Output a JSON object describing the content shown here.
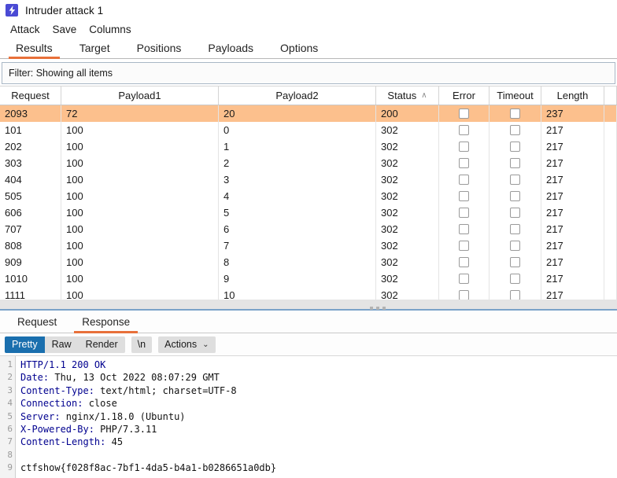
{
  "window": {
    "title": "Intruder attack 1",
    "icon": "lightning-bolt-icon"
  },
  "menubar": {
    "items": [
      {
        "label": "Attack"
      },
      {
        "label": "Save"
      },
      {
        "label": "Columns"
      }
    ]
  },
  "main_tabs": {
    "active": "Results",
    "items": [
      {
        "label": "Results"
      },
      {
        "label": "Target"
      },
      {
        "label": "Positions"
      },
      {
        "label": "Payloads"
      },
      {
        "label": "Options"
      }
    ]
  },
  "filter": {
    "text": "Filter: Showing all items"
  },
  "results_table": {
    "columns": [
      {
        "key": "request",
        "label": "Request",
        "sort": ""
      },
      {
        "key": "payload1",
        "label": "Payload1",
        "sort": ""
      },
      {
        "key": "payload2",
        "label": "Payload2",
        "sort": ""
      },
      {
        "key": "status",
        "label": "Status",
        "sort": "asc"
      },
      {
        "key": "error",
        "label": "Error",
        "sort": ""
      },
      {
        "key": "timeout",
        "label": "Timeout",
        "sort": ""
      },
      {
        "key": "length",
        "label": "Length",
        "sort": ""
      }
    ],
    "sort_caret_asc": "∧",
    "selected_row_index": 0,
    "selected_row_color": "#fcc08d",
    "rows": [
      {
        "request": "2093",
        "payload1": "72",
        "payload2": "20",
        "status": "200",
        "error": false,
        "timeout": false,
        "length": "237"
      },
      {
        "request": "101",
        "payload1": "100",
        "payload2": "0",
        "status": "302",
        "error": false,
        "timeout": false,
        "length": "217"
      },
      {
        "request": "202",
        "payload1": "100",
        "payload2": "1",
        "status": "302",
        "error": false,
        "timeout": false,
        "length": "217"
      },
      {
        "request": "303",
        "payload1": "100",
        "payload2": "2",
        "status": "302",
        "error": false,
        "timeout": false,
        "length": "217"
      },
      {
        "request": "404",
        "payload1": "100",
        "payload2": "3",
        "status": "302",
        "error": false,
        "timeout": false,
        "length": "217"
      },
      {
        "request": "505",
        "payload1": "100",
        "payload2": "4",
        "status": "302",
        "error": false,
        "timeout": false,
        "length": "217"
      },
      {
        "request": "606",
        "payload1": "100",
        "payload2": "5",
        "status": "302",
        "error": false,
        "timeout": false,
        "length": "217"
      },
      {
        "request": "707",
        "payload1": "100",
        "payload2": "6",
        "status": "302",
        "error": false,
        "timeout": false,
        "length": "217"
      },
      {
        "request": "808",
        "payload1": "100",
        "payload2": "7",
        "status": "302",
        "error": false,
        "timeout": false,
        "length": "217"
      },
      {
        "request": "909",
        "payload1": "100",
        "payload2": "8",
        "status": "302",
        "error": false,
        "timeout": false,
        "length": "217"
      },
      {
        "request": "1010",
        "payload1": "100",
        "payload2": "9",
        "status": "302",
        "error": false,
        "timeout": false,
        "length": "217"
      },
      {
        "request": "1111",
        "payload1": "100",
        "payload2": "10",
        "status": "302",
        "error": false,
        "timeout": false,
        "length": "217"
      }
    ]
  },
  "splitter": {
    "grip": "drag-grip-dots"
  },
  "message_tabs": {
    "active": "Response",
    "items": [
      {
        "label": "Request"
      },
      {
        "label": "Response"
      }
    ]
  },
  "message_toolbar": {
    "view_modes": [
      {
        "label": "Pretty",
        "active": true
      },
      {
        "label": "Raw",
        "active": false
      },
      {
        "label": "Render",
        "active": false
      }
    ],
    "newline_button": "\\n",
    "actions_button": "Actions",
    "actions_chevron": "⌄",
    "active_color": "#1a6fae"
  },
  "response": {
    "line_numbers": [
      "1",
      "2",
      "3",
      "4",
      "5",
      "6",
      "7",
      "8",
      "9"
    ],
    "lines": [
      {
        "n": "1",
        "header": "HTTP/1.1 200 OK",
        "value": ""
      },
      {
        "n": "2",
        "header": "Date:",
        "value": " Thu, 13 Oct 2022 08:07:29 GMT"
      },
      {
        "n": "3",
        "header": "Content-Type:",
        "value": " text/html; charset=UTF-8"
      },
      {
        "n": "4",
        "header": "Connection:",
        "value": " close"
      },
      {
        "n": "5",
        "header": "Server:",
        "value": " nginx/1.18.0 (Ubuntu)"
      },
      {
        "n": "6",
        "header": "X-Powered-By:",
        "value": " PHP/7.3.11"
      },
      {
        "n": "7",
        "header": "Content-Length:",
        "value": " 45"
      },
      {
        "n": "8",
        "header": "",
        "value": ""
      },
      {
        "n": "9",
        "header": "",
        "value": "ctfshow{f028f8ac-7bf1-4da5-b4a1-b0286651a0db}"
      }
    ]
  }
}
